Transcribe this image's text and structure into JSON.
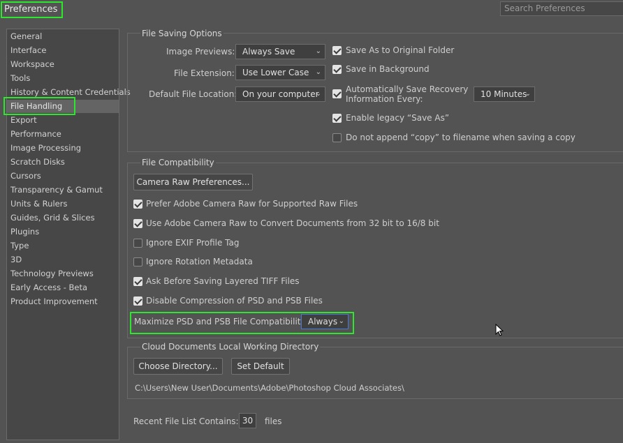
{
  "dialog": {
    "title": "Preferences",
    "search_placeholder": "Search Preferences"
  },
  "sidebar": {
    "items": [
      {
        "label": "General"
      },
      {
        "label": "Interface"
      },
      {
        "label": "Workspace"
      },
      {
        "label": "Tools"
      },
      {
        "label": "History & Content Credentials"
      },
      {
        "label": "File Handling",
        "selected": true
      },
      {
        "label": "Export"
      },
      {
        "label": "Performance"
      },
      {
        "label": "Image Processing"
      },
      {
        "label": "Scratch Disks"
      },
      {
        "label": "Cursors"
      },
      {
        "label": "Transparency & Gamut"
      },
      {
        "label": "Units & Rulers"
      },
      {
        "label": "Guides, Grid & Slices"
      },
      {
        "label": "Plugins"
      },
      {
        "label": "Type"
      },
      {
        "label": "3D"
      },
      {
        "label": "Technology Previews"
      },
      {
        "label": "Early Access - Beta"
      },
      {
        "label": "Product Improvement"
      }
    ]
  },
  "file_saving": {
    "title": "File Saving Options",
    "image_previews": {
      "label": "Image Previews:",
      "value": "Always Save"
    },
    "file_extension": {
      "label": "File Extension:",
      "value": "Use Lower Case"
    },
    "default_location": {
      "label": "Default File Location:",
      "value": "On your computer"
    },
    "save_as_original": {
      "label": "Save As to Original Folder",
      "checked": true
    },
    "save_in_background": {
      "label": "Save in Background",
      "checked": true
    },
    "auto_recovery": {
      "label_line1": "Automatically Save Recovery",
      "label_line2": "Information Every:",
      "checked": true,
      "value": "10 Minutes"
    },
    "legacy_save_as": {
      "label": "Enable legacy “Save As”",
      "checked": true
    },
    "no_copy": {
      "label": "Do not append “copy” to filename when saving a copy",
      "checked": false
    }
  },
  "file_compat": {
    "title": "File Compatibility",
    "camera_raw_button": "Camera Raw Preferences...",
    "options": [
      {
        "label": "Prefer Adobe Camera Raw for Supported Raw Files",
        "checked": true
      },
      {
        "label": "Use Adobe Camera Raw to Convert Documents from 32 bit to 16/8 bit",
        "checked": true
      },
      {
        "label": "Ignore EXIF Profile Tag",
        "checked": false
      },
      {
        "label": "Ignore Rotation Metadata",
        "checked": false
      },
      {
        "label": "Ask Before Saving Layered TIFF Files",
        "checked": true
      },
      {
        "label": "Disable Compression of PSD and PSB Files",
        "checked": true
      }
    ],
    "maximize": {
      "label": "Maximize PSD and PSB File Compatibility:",
      "value": "Always"
    }
  },
  "cloud": {
    "title": "Cloud Documents Local Working Directory",
    "choose_button": "Choose Directory...",
    "default_button": "Set Default",
    "path": "C:\\Users\\New User\\Documents\\Adobe\\Photoshop Cloud Associates\\"
  },
  "recent": {
    "label": "Recent File List Contains:",
    "value": "30",
    "suffix": "files"
  },
  "colors": {
    "background": "#535353",
    "panel": "#474747",
    "highlight": "#2ee62e"
  }
}
